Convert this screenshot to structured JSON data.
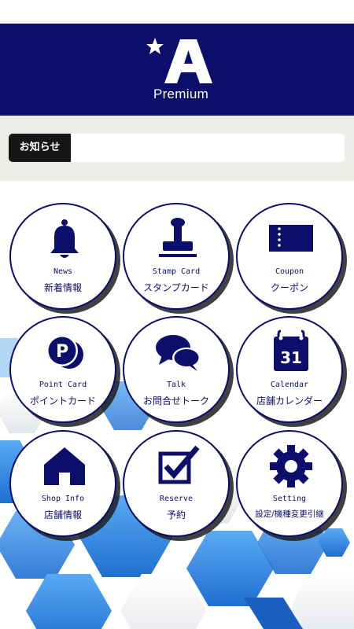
{
  "header": {
    "brand_text": "Premium"
  },
  "notice": {
    "label": "お知らせ"
  },
  "menu": [
    {
      "en": "News",
      "jp": "新着情報",
      "icon": "bell-icon"
    },
    {
      "en": "Stamp Card",
      "jp": "スタンプカード",
      "icon": "stamp-icon"
    },
    {
      "en": "Coupon",
      "jp": "クーポン",
      "icon": "ticket-icon"
    },
    {
      "en": "Point Card",
      "jp": "ポイントカード",
      "icon": "point-coin-icon"
    },
    {
      "en": "Talk",
      "jp": "お問合せトーク",
      "icon": "chat-bubbles-icon"
    },
    {
      "en": "Calendar",
      "jp": "店舗カレンダー",
      "icon": "calendar-icon",
      "icon_text": "31"
    },
    {
      "en": "Shop Info",
      "jp": "店舗情報",
      "icon": "house-icon"
    },
    {
      "en": "Reserve",
      "jp": "予約",
      "icon": "checkbox-icon"
    },
    {
      "en": "Setting",
      "jp": "設定/機種変更引継",
      "icon": "gear-icon"
    }
  ],
  "colors": {
    "brand_navy": "#0b0f6b",
    "notice_band": "#efede9",
    "notice_label_bg": "#151515",
    "hex_blue": "#2a8be6"
  }
}
